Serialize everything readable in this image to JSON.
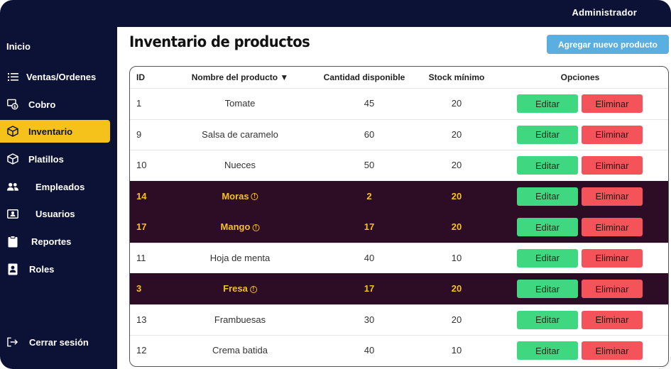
{
  "header": {
    "user_label": "Administrador"
  },
  "sidebar": {
    "home": "Inicio",
    "items": [
      {
        "label": "Ventas/Ordenes",
        "icon": "list-icon",
        "active": false
      },
      {
        "label": "Cobro",
        "icon": "cash-icon",
        "active": false
      },
      {
        "label": "Inventario",
        "icon": "box-icon",
        "active": true
      },
      {
        "label": "Platillos",
        "icon": "box-icon",
        "active": false
      },
      {
        "label": "Empleados",
        "icon": "people-icon",
        "active": false
      },
      {
        "label": "Usuarios",
        "icon": "id-card-icon",
        "active": false
      },
      {
        "label": "Reportes",
        "icon": "clipboard-icon",
        "active": false
      },
      {
        "label": "Roles",
        "icon": "badge-icon",
        "active": false
      }
    ],
    "logout": "Cerrar sesión"
  },
  "main": {
    "title": "Inventario de productos",
    "add_button": "Agregar nuevo producto",
    "columns": [
      "ID",
      "Nombre del producto ▼",
      "Cantidad disponible",
      "Stock mínimo",
      "Opciones"
    ],
    "rows": [
      {
        "id": "1",
        "name": "Tomate",
        "qty": "45",
        "min": "20",
        "alert": false
      },
      {
        "id": "9",
        "name": "Salsa de caramelo",
        "qty": "60",
        "min": "20",
        "alert": false
      },
      {
        "id": "10",
        "name": "Nueces",
        "qty": "50",
        "min": "20",
        "alert": false
      },
      {
        "id": "14",
        "name": "Moras",
        "qty": "2",
        "min": "20",
        "alert": true
      },
      {
        "id": "17",
        "name": "Mango",
        "qty": "17",
        "min": "20",
        "alert": true
      },
      {
        "id": "11",
        "name": "Hoja de menta",
        "qty": "40",
        "min": "10",
        "alert": false
      },
      {
        "id": "3",
        "name": "Fresa",
        "qty": "17",
        "min": "20",
        "alert": true
      },
      {
        "id": "13",
        "name": "Frambuesas",
        "qty": "30",
        "min": "20",
        "alert": false
      },
      {
        "id": "12",
        "name": "Crema batida",
        "qty": "40",
        "min": "10",
        "alert": false
      }
    ],
    "edit_label": "Editar",
    "delete_label": "Eliminar",
    "warning_icon": "info-circle-icon"
  },
  "colors": {
    "background": "#0c1236",
    "active_nav": "#f5c21b",
    "alert_row": "#2d0c25",
    "alert_text": "#f5c21b",
    "edit_button": "#3fd77f",
    "delete_button": "#f5535a",
    "add_button": "#5aaee0"
  }
}
